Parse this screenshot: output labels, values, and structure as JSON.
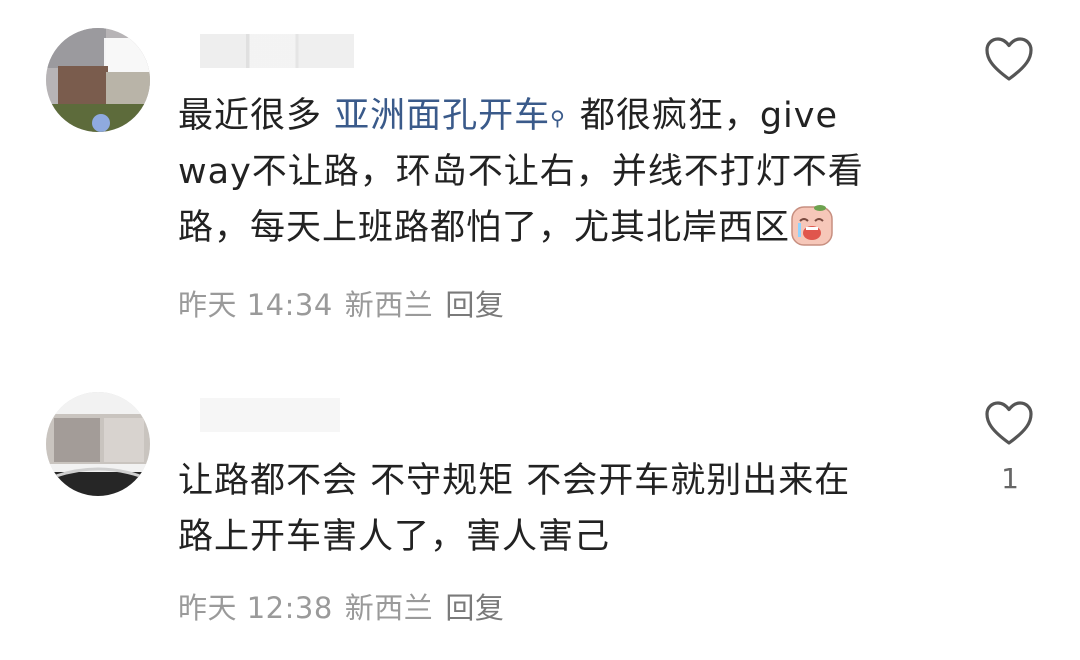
{
  "comments": [
    {
      "body_parts": {
        "before_link": "最近很多 ",
        "link": "亚洲面孔开车",
        "after_link_line1": "都很疯狂，give",
        "line2": "way不让路，环岛不让右，并线不打灯不看",
        "line3": "路，每天上班路都怕了，尤其北岸西区"
      },
      "time": "昨天 14:34",
      "location": "新西兰",
      "reply_label": "回复",
      "like_count": ""
    },
    {
      "body_parts": {
        "line1": "让路都不会 不守规矩 不会开车就别出来在",
        "line2": "路上开车害人了，害人害己"
      },
      "time": "昨天 12:38",
      "location": "新西兰",
      "reply_label": "回复",
      "like_count": "1"
    }
  ],
  "icons": {
    "like": "heart-outline-icon",
    "search_link": "search-link-icon",
    "emoji": "crying-face-emoji"
  },
  "colors": {
    "text": "#222222",
    "link": "#3a5a8a",
    "meta": "#9a9a9a"
  }
}
